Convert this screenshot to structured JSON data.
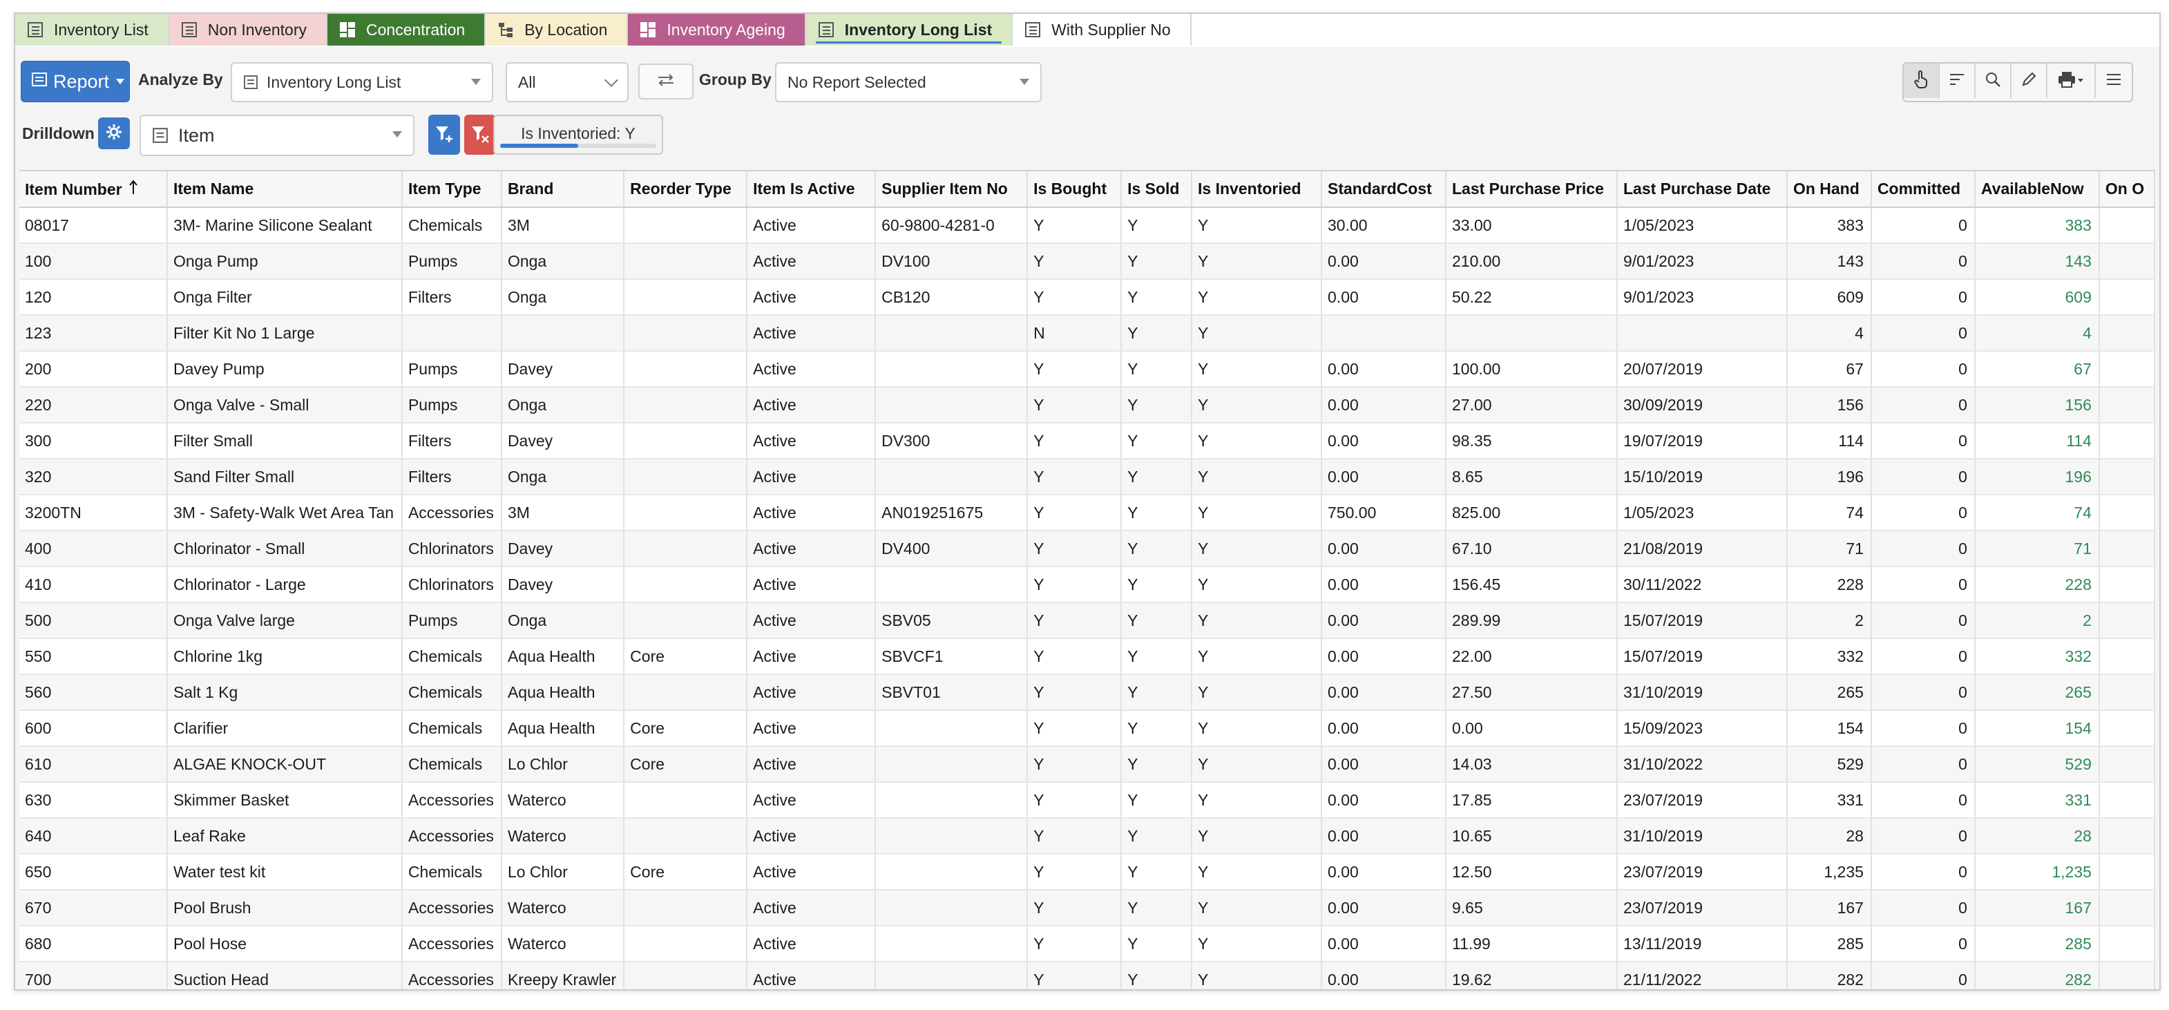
{
  "tabs": [
    {
      "label": "Inventory List",
      "color": "#d9e8c8",
      "icon": "list-icon"
    },
    {
      "label": "Non Inventory",
      "color": "#f4d2d4",
      "icon": "list-icon"
    },
    {
      "label": "Concentration",
      "color": "#3f7a33",
      "icon": "grid-icon"
    },
    {
      "label": "By Location",
      "color": "#f8eecb",
      "icon": "tree-icon"
    },
    {
      "label": "Inventory Ageing",
      "color": "#b85e8f",
      "icon": "grid-icon"
    },
    {
      "label": "Inventory Long List",
      "color": "#d8e9c4",
      "icon": "list-icon"
    },
    {
      "label": "With Supplier No",
      "color": "#ffffff",
      "icon": "list-icon"
    }
  ],
  "toolbar": {
    "report_label": "Report",
    "analyze_label": "Analyze By",
    "analyze_value": "Inventory Long List",
    "period_value": "All",
    "group_label": "Group By",
    "group_value": "No Report Selected"
  },
  "drilldown": {
    "label": "Drilldown",
    "value": "Item",
    "chip_label": "Is Inventoried: Y",
    "chip_progress": 0.5
  },
  "table": {
    "columns": [
      "Item Number",
      "Item Name",
      "Item Type",
      "Brand",
      "Reorder Type",
      "Item Is Active",
      "Supplier Item No",
      "Is Bought",
      "Is Sold",
      "Is Inventoried",
      "StandardCost",
      "Last Purchase Price",
      "Last Purchase Date",
      "On Hand",
      "Committed",
      "AvailableNow",
      "On O"
    ],
    "rows": [
      [
        "08017",
        "3M- Marine Silicone Sealant",
        "Chemicals",
        "3M",
        "",
        "Active",
        "60-9800-4281-0",
        "Y",
        "Y",
        "Y",
        "30.00",
        "33.00",
        "1/05/2023",
        "383",
        "0",
        "383",
        ""
      ],
      [
        "100",
        "Onga Pump",
        "Pumps",
        "Onga",
        "",
        "Active",
        "DV100",
        "Y",
        "Y",
        "Y",
        "0.00",
        "210.00",
        "9/01/2023",
        "143",
        "0",
        "143",
        ""
      ],
      [
        "120",
        "Onga Filter",
        "Filters",
        "Onga",
        "",
        "Active",
        "CB120",
        "Y",
        "Y",
        "Y",
        "0.00",
        "50.22",
        "9/01/2023",
        "609",
        "0",
        "609",
        ""
      ],
      [
        "123",
        "Filter Kit No 1 Large",
        "",
        "",
        "",
        "Active",
        "",
        "N",
        "Y",
        "Y",
        "",
        "",
        "",
        "4",
        "0",
        "4",
        ""
      ],
      [
        "200",
        "Davey Pump",
        "Pumps",
        "Davey",
        "",
        "Active",
        "",
        "Y",
        "Y",
        "Y",
        "0.00",
        "100.00",
        "20/07/2019",
        "67",
        "0",
        "67",
        ""
      ],
      [
        "220",
        "Onga Valve - Small",
        "Pumps",
        "Onga",
        "",
        "Active",
        "",
        "Y",
        "Y",
        "Y",
        "0.00",
        "27.00",
        "30/09/2019",
        "156",
        "0",
        "156",
        ""
      ],
      [
        "300",
        "Filter Small",
        "Filters",
        "Davey",
        "",
        "Active",
        "DV300",
        "Y",
        "Y",
        "Y",
        "0.00",
        "98.35",
        "19/07/2019",
        "114",
        "0",
        "114",
        ""
      ],
      [
        "320",
        "Sand Filter Small",
        "Filters",
        "Onga",
        "",
        "Active",
        "",
        "Y",
        "Y",
        "Y",
        "0.00",
        "8.65",
        "15/10/2019",
        "196",
        "0",
        "196",
        ""
      ],
      [
        "3200TN",
        "3M - Safety-Walk Wet Area Tan",
        "Accessories",
        "3M",
        "",
        "Active",
        "AN019251675",
        "Y",
        "Y",
        "Y",
        "750.00",
        "825.00",
        "1/05/2023",
        "74",
        "0",
        "74",
        ""
      ],
      [
        "400",
        "Chlorinator - Small",
        "Chlorinators",
        "Davey",
        "",
        "Active",
        "DV400",
        "Y",
        "Y",
        "Y",
        "0.00",
        "67.10",
        "21/08/2019",
        "71",
        "0",
        "71",
        ""
      ],
      [
        "410",
        "Chlorinator - Large",
        "Chlorinators",
        "Davey",
        "",
        "Active",
        "",
        "Y",
        "Y",
        "Y",
        "0.00",
        "156.45",
        "30/11/2022",
        "228",
        "0",
        "228",
        ""
      ],
      [
        "500",
        "Onga Valve large",
        "Pumps",
        "Onga",
        "",
        "Active",
        "SBV05",
        "Y",
        "Y",
        "Y",
        "0.00",
        "289.99",
        "15/07/2019",
        "2",
        "0",
        "2",
        ""
      ],
      [
        "550",
        "Chlorine 1kg",
        "Chemicals",
        "Aqua Health",
        "Core",
        "Active",
        "SBVCF1",
        "Y",
        "Y",
        "Y",
        "0.00",
        "22.00",
        "15/07/2019",
        "332",
        "0",
        "332",
        ""
      ],
      [
        "560",
        "Salt 1 Kg",
        "Chemicals",
        "Aqua Health",
        "",
        "Active",
        "SBVT01",
        "Y",
        "Y",
        "Y",
        "0.00",
        "27.50",
        "31/10/2019",
        "265",
        "0",
        "265",
        ""
      ],
      [
        "600",
        "Clarifier",
        "Chemicals",
        "Aqua Health",
        "Core",
        "Active",
        "",
        "Y",
        "Y",
        "Y",
        "0.00",
        "0.00",
        "15/09/2023",
        "154",
        "0",
        "154",
        ""
      ],
      [
        "610",
        "ALGAE KNOCK-OUT",
        "Chemicals",
        "Lo Chlor",
        "Core",
        "Active",
        "",
        "Y",
        "Y",
        "Y",
        "0.00",
        "14.03",
        "31/10/2022",
        "529",
        "0",
        "529",
        ""
      ],
      [
        "630",
        "Skimmer Basket",
        "Accessories",
        "Waterco",
        "",
        "Active",
        "",
        "Y",
        "Y",
        "Y",
        "0.00",
        "17.85",
        "23/07/2019",
        "331",
        "0",
        "331",
        ""
      ],
      [
        "640",
        "Leaf Rake",
        "Accessories",
        "Waterco",
        "",
        "Active",
        "",
        "Y",
        "Y",
        "Y",
        "0.00",
        "10.65",
        "31/10/2019",
        "28",
        "0",
        "28",
        ""
      ],
      [
        "650",
        "Water test kit",
        "Chemicals",
        "Lo Chlor",
        "Core",
        "Active",
        "",
        "Y",
        "Y",
        "Y",
        "0.00",
        "12.50",
        "23/07/2019",
        "1,235",
        "0",
        "1,235",
        ""
      ],
      [
        "670",
        "Pool Brush",
        "Accessories",
        "Waterco",
        "",
        "Active",
        "",
        "Y",
        "Y",
        "Y",
        "0.00",
        "9.65",
        "23/07/2019",
        "167",
        "0",
        "167",
        ""
      ],
      [
        "680",
        "Pool Hose",
        "Accessories",
        "Waterco",
        "",
        "Active",
        "",
        "Y",
        "Y",
        "Y",
        "0.00",
        "11.99",
        "13/11/2019",
        "285",
        "0",
        "285",
        ""
      ],
      [
        "700",
        "Suction Head",
        "Accessories",
        "Kreepy Krawler",
        "",
        "Active",
        "",
        "Y",
        "Y",
        "Y",
        "0.00",
        "19.62",
        "21/11/2022",
        "282",
        "0",
        "282",
        ""
      ]
    ]
  }
}
